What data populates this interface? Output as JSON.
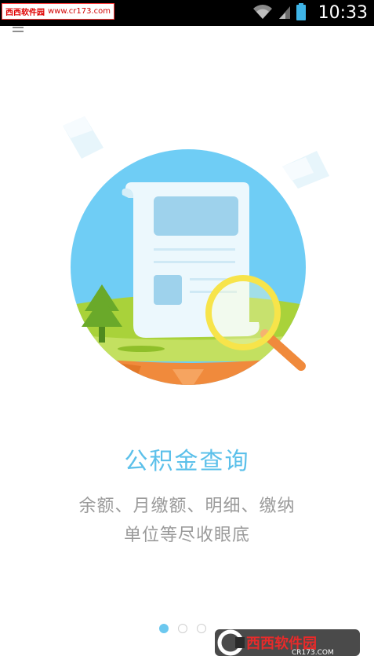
{
  "status_bar": {
    "time": "10:33",
    "wifi_icon": "wifi-icon",
    "signal_icon": "signal-icon",
    "battery_icon": "battery-icon"
  },
  "watermark": {
    "top_brand": "西西软件园",
    "top_url": "www.cr173.com",
    "bottom_brand": "西西软件园",
    "bottom_url": "CR173.COM"
  },
  "onboarding": {
    "illustration_icon": "document-search-illustration",
    "title": "公积金查询",
    "desc_line1": "余额、月缴额、明细、缴纳",
    "desc_line2": "单位等尽收眼底",
    "page_count": 3,
    "current_page": 1
  },
  "colors": {
    "accent": "#5bc0ea",
    "sky": "#6fcdf5",
    "grass": "#a9d23a",
    "soil": "#f08a3c",
    "magnifier": "#f7e44a",
    "text_gray": "#9a9a9a"
  }
}
